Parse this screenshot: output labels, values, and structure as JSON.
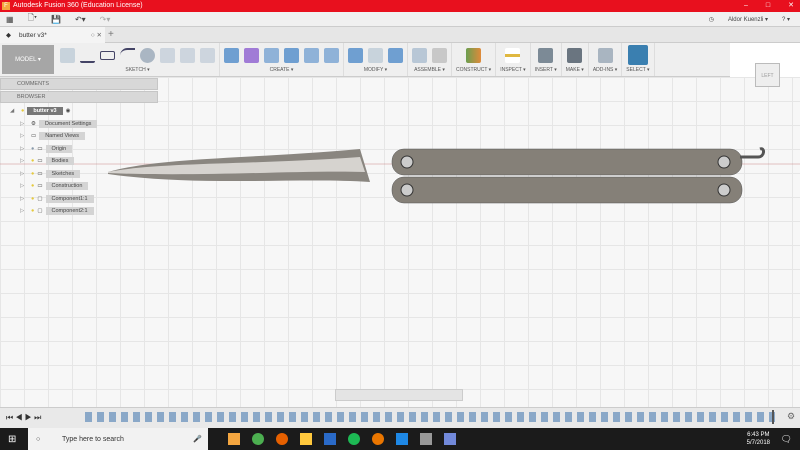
{
  "app": {
    "title": "Autodesk Fusion 360 (Education License)",
    "logo": "F"
  },
  "window_controls": [
    "–",
    "□",
    "✕"
  ],
  "user": {
    "name": "Aldor Kuenzli ▾",
    "help": "? ▾"
  },
  "document_tab": {
    "label": "butter v3*"
  },
  "workspace": "MODEL ▾",
  "toolbar_groups": [
    "SKETCH ▾",
    "CREATE ▾",
    "MODIFY ▾",
    "ASSEMBLE ▾",
    "CONSTRUCT ▾",
    "INSPECT ▾",
    "INSERT ▾",
    "MAKE ▾",
    "ADD-INS ▾",
    "SELECT ▾"
  ],
  "panels": {
    "comments": "COMMENTS",
    "browser": "BROWSER"
  },
  "browser": {
    "root": "butter v3",
    "items": [
      "Document Settings",
      "Named Views",
      "Origin",
      "Bodies",
      "Sketches",
      "Construction",
      "Component1:1",
      "Component2:1"
    ]
  },
  "viewcube": "LEFT",
  "taskbar": {
    "search_placeholder": "Type here to search",
    "time": "6:43 PM",
    "date": "5/7/2018"
  }
}
